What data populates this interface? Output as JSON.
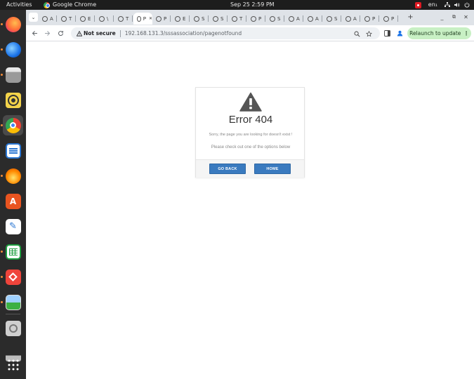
{
  "topbar": {
    "activities": "Activities",
    "app_name": "Google Chrome",
    "clock": "Sep 25  2:59 PM",
    "lang": "en₁",
    "icons": [
      "screen-record-icon",
      "network-icon",
      "volume-icon",
      "power-icon"
    ]
  },
  "dock": {
    "apps": [
      "firefox",
      "thunderbird",
      "files",
      "rhythmbox",
      "chrome",
      "libreoffice-writer",
      "burner",
      "app-center",
      "text-editor",
      "libreoffice-calc",
      "anydesk",
      "image-viewer",
      "disk",
      "drive",
      "app-grid"
    ]
  },
  "tabs": [
    {
      "initial": "A"
    },
    {
      "initial": "T"
    },
    {
      "initial": "E"
    },
    {
      "initial": "\\"
    },
    {
      "initial": "T"
    },
    {
      "initial": "P"
    },
    {
      "initial": "P"
    },
    {
      "initial": "E"
    },
    {
      "initial": "S"
    },
    {
      "initial": "S"
    },
    {
      "initial": "T"
    },
    {
      "initial": "P"
    },
    {
      "initial": "S"
    },
    {
      "initial": "A"
    },
    {
      "initial": "A"
    },
    {
      "initial": "S"
    },
    {
      "initial": "A"
    },
    {
      "initial": "P"
    },
    {
      "initial": "P"
    }
  ],
  "toolbar": {
    "security_label": "Not secure",
    "url": "192.168.131.3/sssassociation/pagenotfound",
    "relaunch_label": "Relaunch to update"
  },
  "page": {
    "title": "Error 404",
    "message": "Sorry, the page you are looking for doesn't exist !",
    "hint": "Please check out one of the options below",
    "back_label": "GO BACK",
    "home_label": "HOME",
    "accent_color": "#3a7abf"
  }
}
